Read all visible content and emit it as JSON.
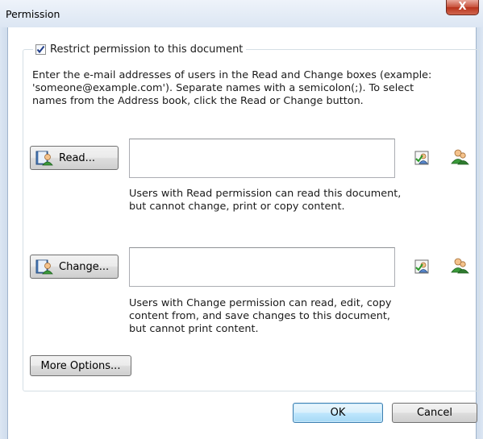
{
  "window": {
    "title": "Permission",
    "close_glyph": "X"
  },
  "restrict": {
    "label": "Restrict permission to this document",
    "checked": true
  },
  "instructions": "Enter the e-mail addresses of users in the Read and Change boxes (example:\n'someone@example.com'). Separate names with a semicolon(;). To select\nnames from the Address book, click the Read or Change button.",
  "read": {
    "button_label": "Read...",
    "value": "",
    "description": "Users with Read permission can read this document,\nbut cannot change, print or copy content.",
    "icons": [
      "check-names-icon",
      "address-book-user-icon"
    ]
  },
  "change": {
    "button_label": "Change...",
    "value": "",
    "description": "Users with Change permission can read, edit, copy\ncontent from, and save changes to this document,\nbut cannot print content.",
    "icons": [
      "check-names-icon",
      "address-book-user-icon"
    ]
  },
  "more_options_label": "More Options...",
  "ok_label": "OK",
  "cancel_label": "Cancel",
  "colors": {
    "title_bar": "#dce6f3",
    "close_button": "#c7503a",
    "default_button_border": "#3c7fb1"
  }
}
